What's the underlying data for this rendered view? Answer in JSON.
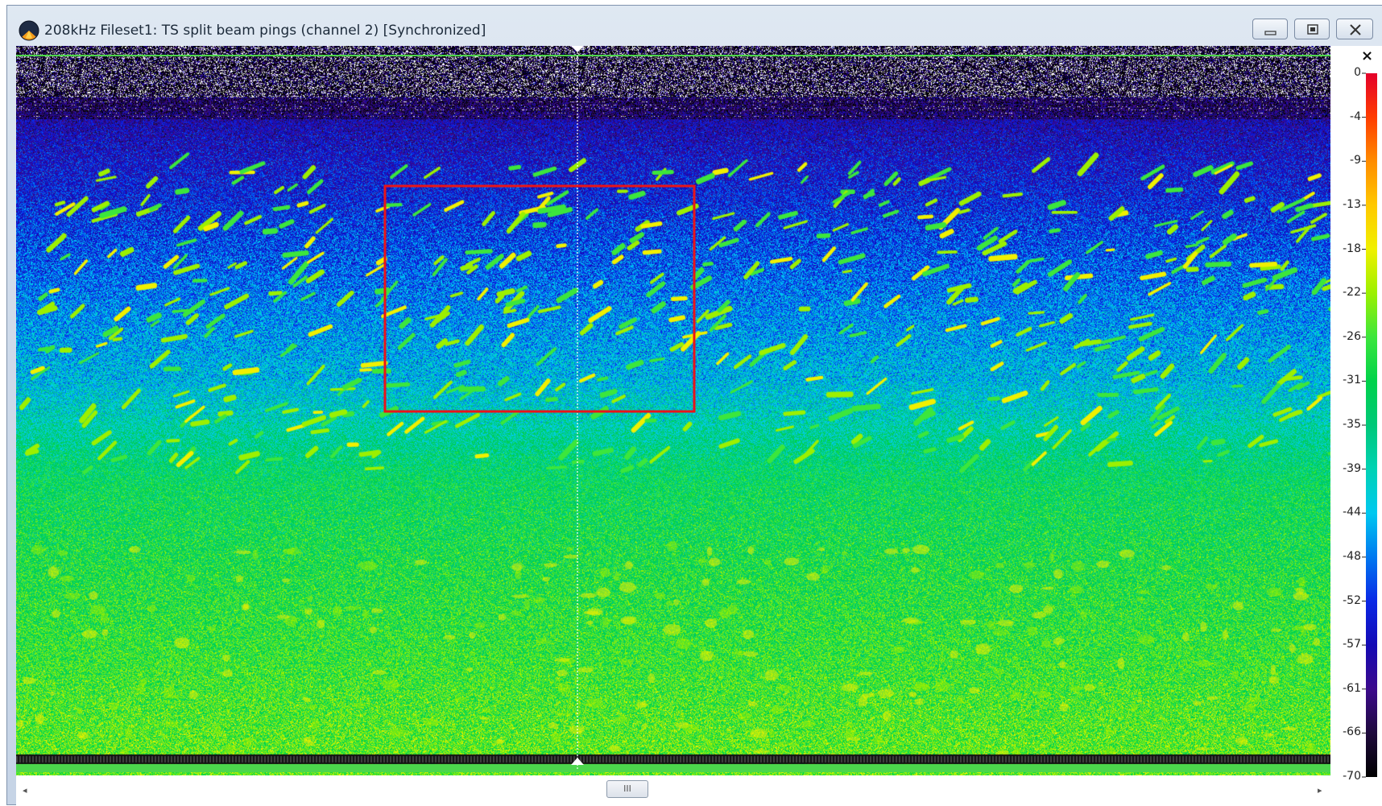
{
  "window": {
    "title": "208kHz Fileset1: TS split beam pings (channel 2) [Synchronized]",
    "minimize_icon": "minimize-icon",
    "maximize_icon": "restore-icon",
    "close_icon": "close-icon"
  },
  "echogram": {
    "highlight_box_color": "#e8141a",
    "cursor_line_color": "#ffffff"
  },
  "colorbar": {
    "close_label": "×",
    "ticks": [
      "0",
      "-4",
      "-9",
      "-13",
      "-18",
      "-22",
      "-26",
      "-31",
      "-35",
      "-39",
      "-44",
      "-48",
      "-52",
      "-57",
      "-61",
      "-66",
      "-70"
    ],
    "colors": [
      "#e4002a",
      "#ff3c00",
      "#ff8c00",
      "#ffc800",
      "#f0f000",
      "#9cf000",
      "#3ce63c",
      "#00d24a",
      "#00c878",
      "#00d2b4",
      "#00c8f0",
      "#0078f0",
      "#0a28e6",
      "#140ab4",
      "#3c0a8c",
      "#1e0a3c",
      "#000000"
    ]
  },
  "scrollbar": {
    "left_arrow": "◂",
    "right_arrow": "▸",
    "thumb_grip": "III"
  }
}
